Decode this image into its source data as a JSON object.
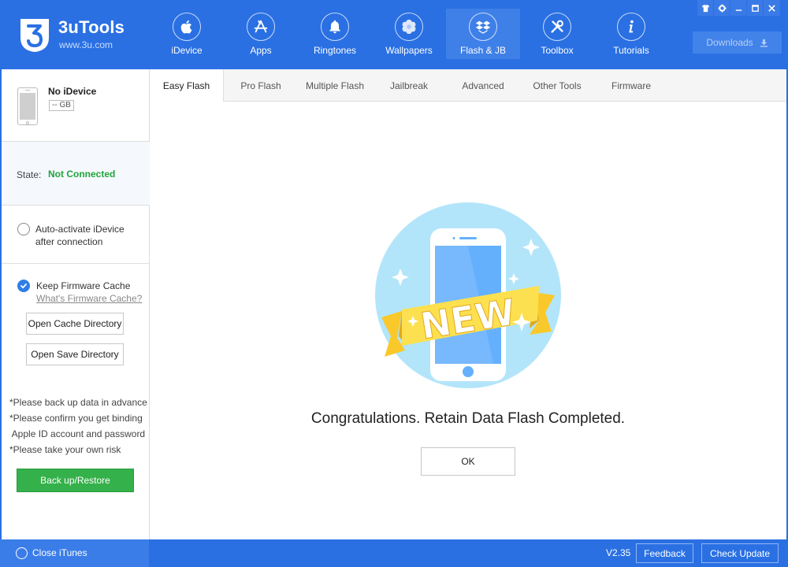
{
  "app": {
    "name": "3uTools",
    "url": "www.3u.com"
  },
  "nav": [
    {
      "label": "iDevice",
      "icon": "apple-icon",
      "active": false
    },
    {
      "label": "Apps",
      "icon": "app-store-icon",
      "active": false
    },
    {
      "label": "Ringtones",
      "icon": "bell-icon",
      "active": false
    },
    {
      "label": "Wallpapers",
      "icon": "flower-icon",
      "active": false
    },
    {
      "label": "Flash & JB",
      "icon": "box-icon",
      "active": true
    },
    {
      "label": "Toolbox",
      "icon": "tools-icon",
      "active": false
    },
    {
      "label": "Tutorials",
      "icon": "info-icon",
      "active": false
    }
  ],
  "window_controls": [
    "skin-icon",
    "settings-icon",
    "minimize-icon",
    "maximize-icon",
    "close-icon"
  ],
  "downloads": {
    "label": "Downloads",
    "icon": "download-icon"
  },
  "device": {
    "name": "No iDevice",
    "capacity": "-- GB",
    "state_label": "State:",
    "state_value": "Not Connected",
    "state_color": "#21a33a"
  },
  "options": {
    "auto_activate": {
      "label_line1": "Auto-activate iDevice",
      "label_line2": "after connection",
      "checked": false
    },
    "keep_cache": {
      "label": "Keep Firmware Cache",
      "link": "What's Firmware Cache?",
      "checked": true
    }
  },
  "sidebar_buttons": {
    "open_cache": "Open Cache Directory",
    "open_save": "Open Save Directory",
    "backup_restore": "Back up/Restore"
  },
  "notes": "*Please back up data in advance\n*Please confirm you get binding\n Apple ID account and password\n*Please take your own risk",
  "tabs": [
    {
      "label": "Easy Flash",
      "active": true
    },
    {
      "label": "Pro Flash",
      "active": false
    },
    {
      "label": "Multiple Flash",
      "active": false
    },
    {
      "label": "Jailbreak",
      "active": false
    },
    {
      "label": "Advanced",
      "active": false
    },
    {
      "label": "Other Tools",
      "active": false
    },
    {
      "label": "Firmware",
      "active": false
    }
  ],
  "main": {
    "badge_text": "NEW",
    "message": "Congratulations. Retain Data Flash Completed.",
    "ok_label": "OK"
  },
  "footer": {
    "close_itunes": "Close iTunes",
    "version": "V2.35",
    "feedback": "Feedback",
    "check_update": "Check Update"
  },
  "colors": {
    "brand_blue": "#2a70e3",
    "success_green": "#34b14a",
    "check_blue": "#2f7ee6"
  }
}
